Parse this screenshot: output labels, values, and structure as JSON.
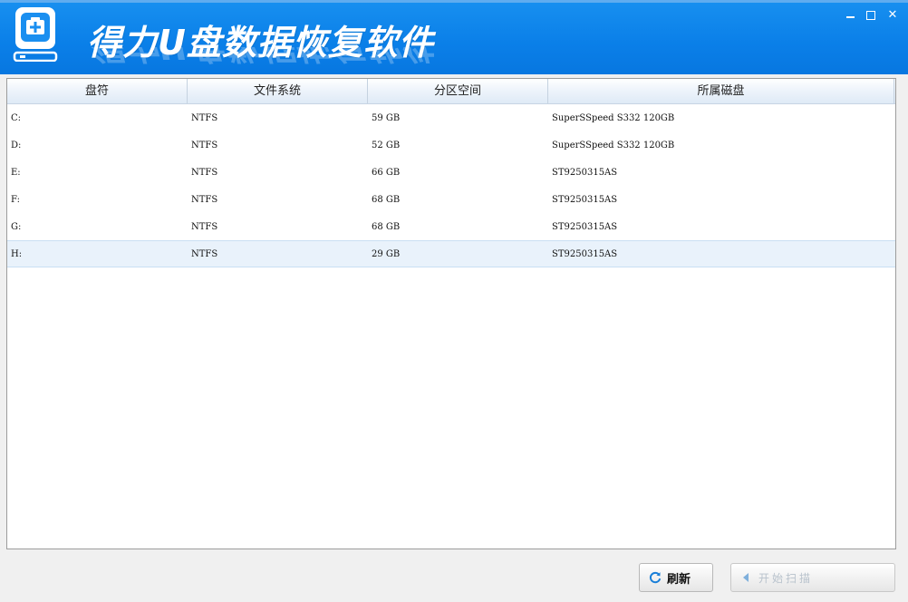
{
  "app": {
    "title": "得力U盘数据恢复软件",
    "brand_color": "#0a80e8"
  },
  "window_controls": {
    "minimize_icon": "minimize-icon",
    "maximize_icon": "maximize-icon",
    "close_label": "✕"
  },
  "table": {
    "columns": [
      "盘符",
      "文件系统",
      "分区空间",
      "所属磁盘"
    ],
    "rows": [
      {
        "drive": "C:",
        "fs": "NTFS",
        "size": "59 GB",
        "disk": "SuperSSpeed S332 120GB"
      },
      {
        "drive": "D:",
        "fs": "NTFS",
        "size": "52 GB",
        "disk": "SuperSSpeed S332 120GB"
      },
      {
        "drive": "E:",
        "fs": "NTFS",
        "size": "66 GB",
        "disk": "ST9250315AS"
      },
      {
        "drive": "F:",
        "fs": "NTFS",
        "size": "68 GB",
        "disk": "ST9250315AS"
      },
      {
        "drive": "G:",
        "fs": "NTFS",
        "size": "68 GB",
        "disk": "ST9250315AS"
      },
      {
        "drive": "H:",
        "fs": "NTFS",
        "size": "29 GB",
        "disk": "ST9250315AS"
      }
    ],
    "selected_row": 5
  },
  "buttons": {
    "refresh_label": "刷新",
    "refresh_icon": "refresh-icon",
    "next_label": "开始扫描",
    "next_icon": "arrow-icon"
  }
}
